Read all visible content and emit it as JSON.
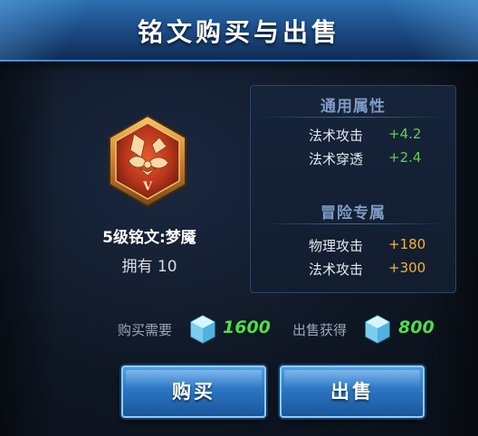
{
  "title": "铭文购买与出售",
  "rune": {
    "name": "5级铭文:梦魇",
    "owned": "拥有 10",
    "tier_numeral": "V",
    "icon": "rune-hexagon-icon"
  },
  "attributes": {
    "common_heading": "通用属性",
    "common": [
      {
        "label": "法术攻击",
        "value": "+4.2"
      },
      {
        "label": "法术穿透",
        "value": "+2.4"
      }
    ],
    "exclusive_heading": "冒险专属",
    "exclusive": [
      {
        "label": "物理攻击",
        "value": "+180"
      },
      {
        "label": "法术攻击",
        "value": "+300"
      }
    ]
  },
  "price": {
    "buy_label": "购买需要",
    "buy_value": "1600",
    "sell_label": "出售获得",
    "sell_value": "800",
    "currency_icon": "crystal-gem-icon"
  },
  "buttons": {
    "buy": "购买",
    "sell": "出售"
  },
  "colors": {
    "bonus_green": "#5ed04a",
    "bonus_orange": "#f2b33a",
    "price_green": "#4ce04a",
    "button_blue": "#2b76c4"
  }
}
